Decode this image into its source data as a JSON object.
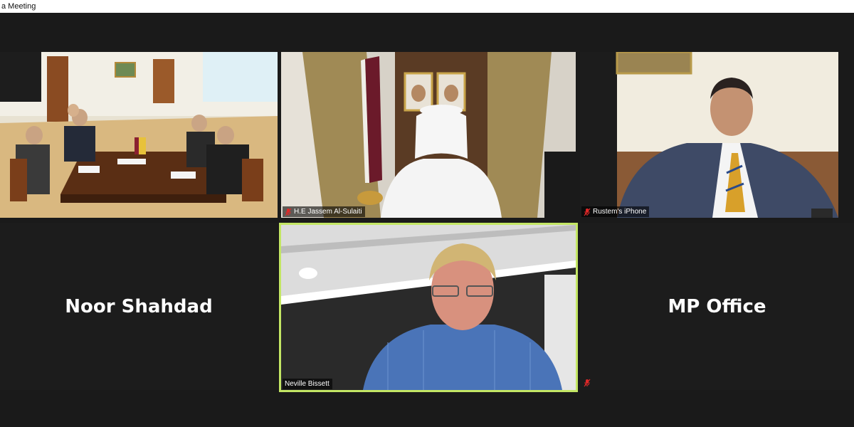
{
  "window": {
    "title": "a Meeting"
  },
  "participants": [
    {
      "id": "conference-room",
      "name": "",
      "muted": false,
      "active": false
    },
    {
      "id": "jassem",
      "name": "H.E Jassem Al-Sulaiti",
      "muted": true,
      "active": false
    },
    {
      "id": "rustem",
      "name": "Rustem's iPhone",
      "muted": true,
      "active": false
    },
    {
      "id": "noor",
      "name": "Noor Shahdad",
      "video": false
    },
    {
      "id": "neville",
      "name": "Neville Bissett",
      "muted": false,
      "active": true
    },
    {
      "id": "mp-office",
      "name": "MP Office",
      "video": false,
      "muted": true
    }
  ],
  "colors": {
    "active_speaker_border": "#c3e664",
    "muted_icon": "#e02828",
    "background": "#1a1a1a"
  },
  "icons": {
    "muted": "mic-muted-icon"
  }
}
